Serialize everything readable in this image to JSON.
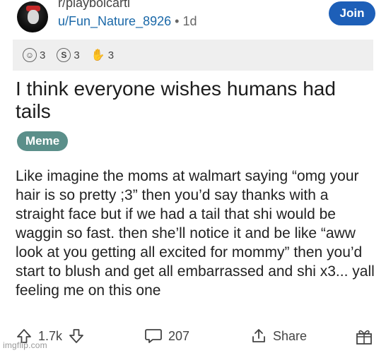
{
  "header": {
    "subreddit": "r/playboicarti",
    "username": "u/Fun_Nature_8926",
    "separator": "•",
    "age": "1d",
    "join_label": "Join"
  },
  "awards": [
    {
      "icon": "helmet-award-icon",
      "count": "3"
    },
    {
      "icon": "s-coin-award-icon",
      "count": "3"
    },
    {
      "icon": "hand-award-icon",
      "count": "3"
    }
  ],
  "post": {
    "title": "I think everyone wishes humans had tails",
    "flair": "Meme",
    "body": "Like imagine the moms at walmart saying “omg your hair is so pretty ;3” then you’d say thanks with a straight face but if we had a tail that shi would be waggin so fast. then she’ll notice it and be like “aww look at you getting all excited for mommy” then you’d start to blush and get all embarrassed and shi x3... yall feeling me on this one"
  },
  "actions": {
    "upvote_count": "1.7k",
    "comment_count": "207",
    "share_label": "Share"
  },
  "watermark": "imgflip.com"
}
